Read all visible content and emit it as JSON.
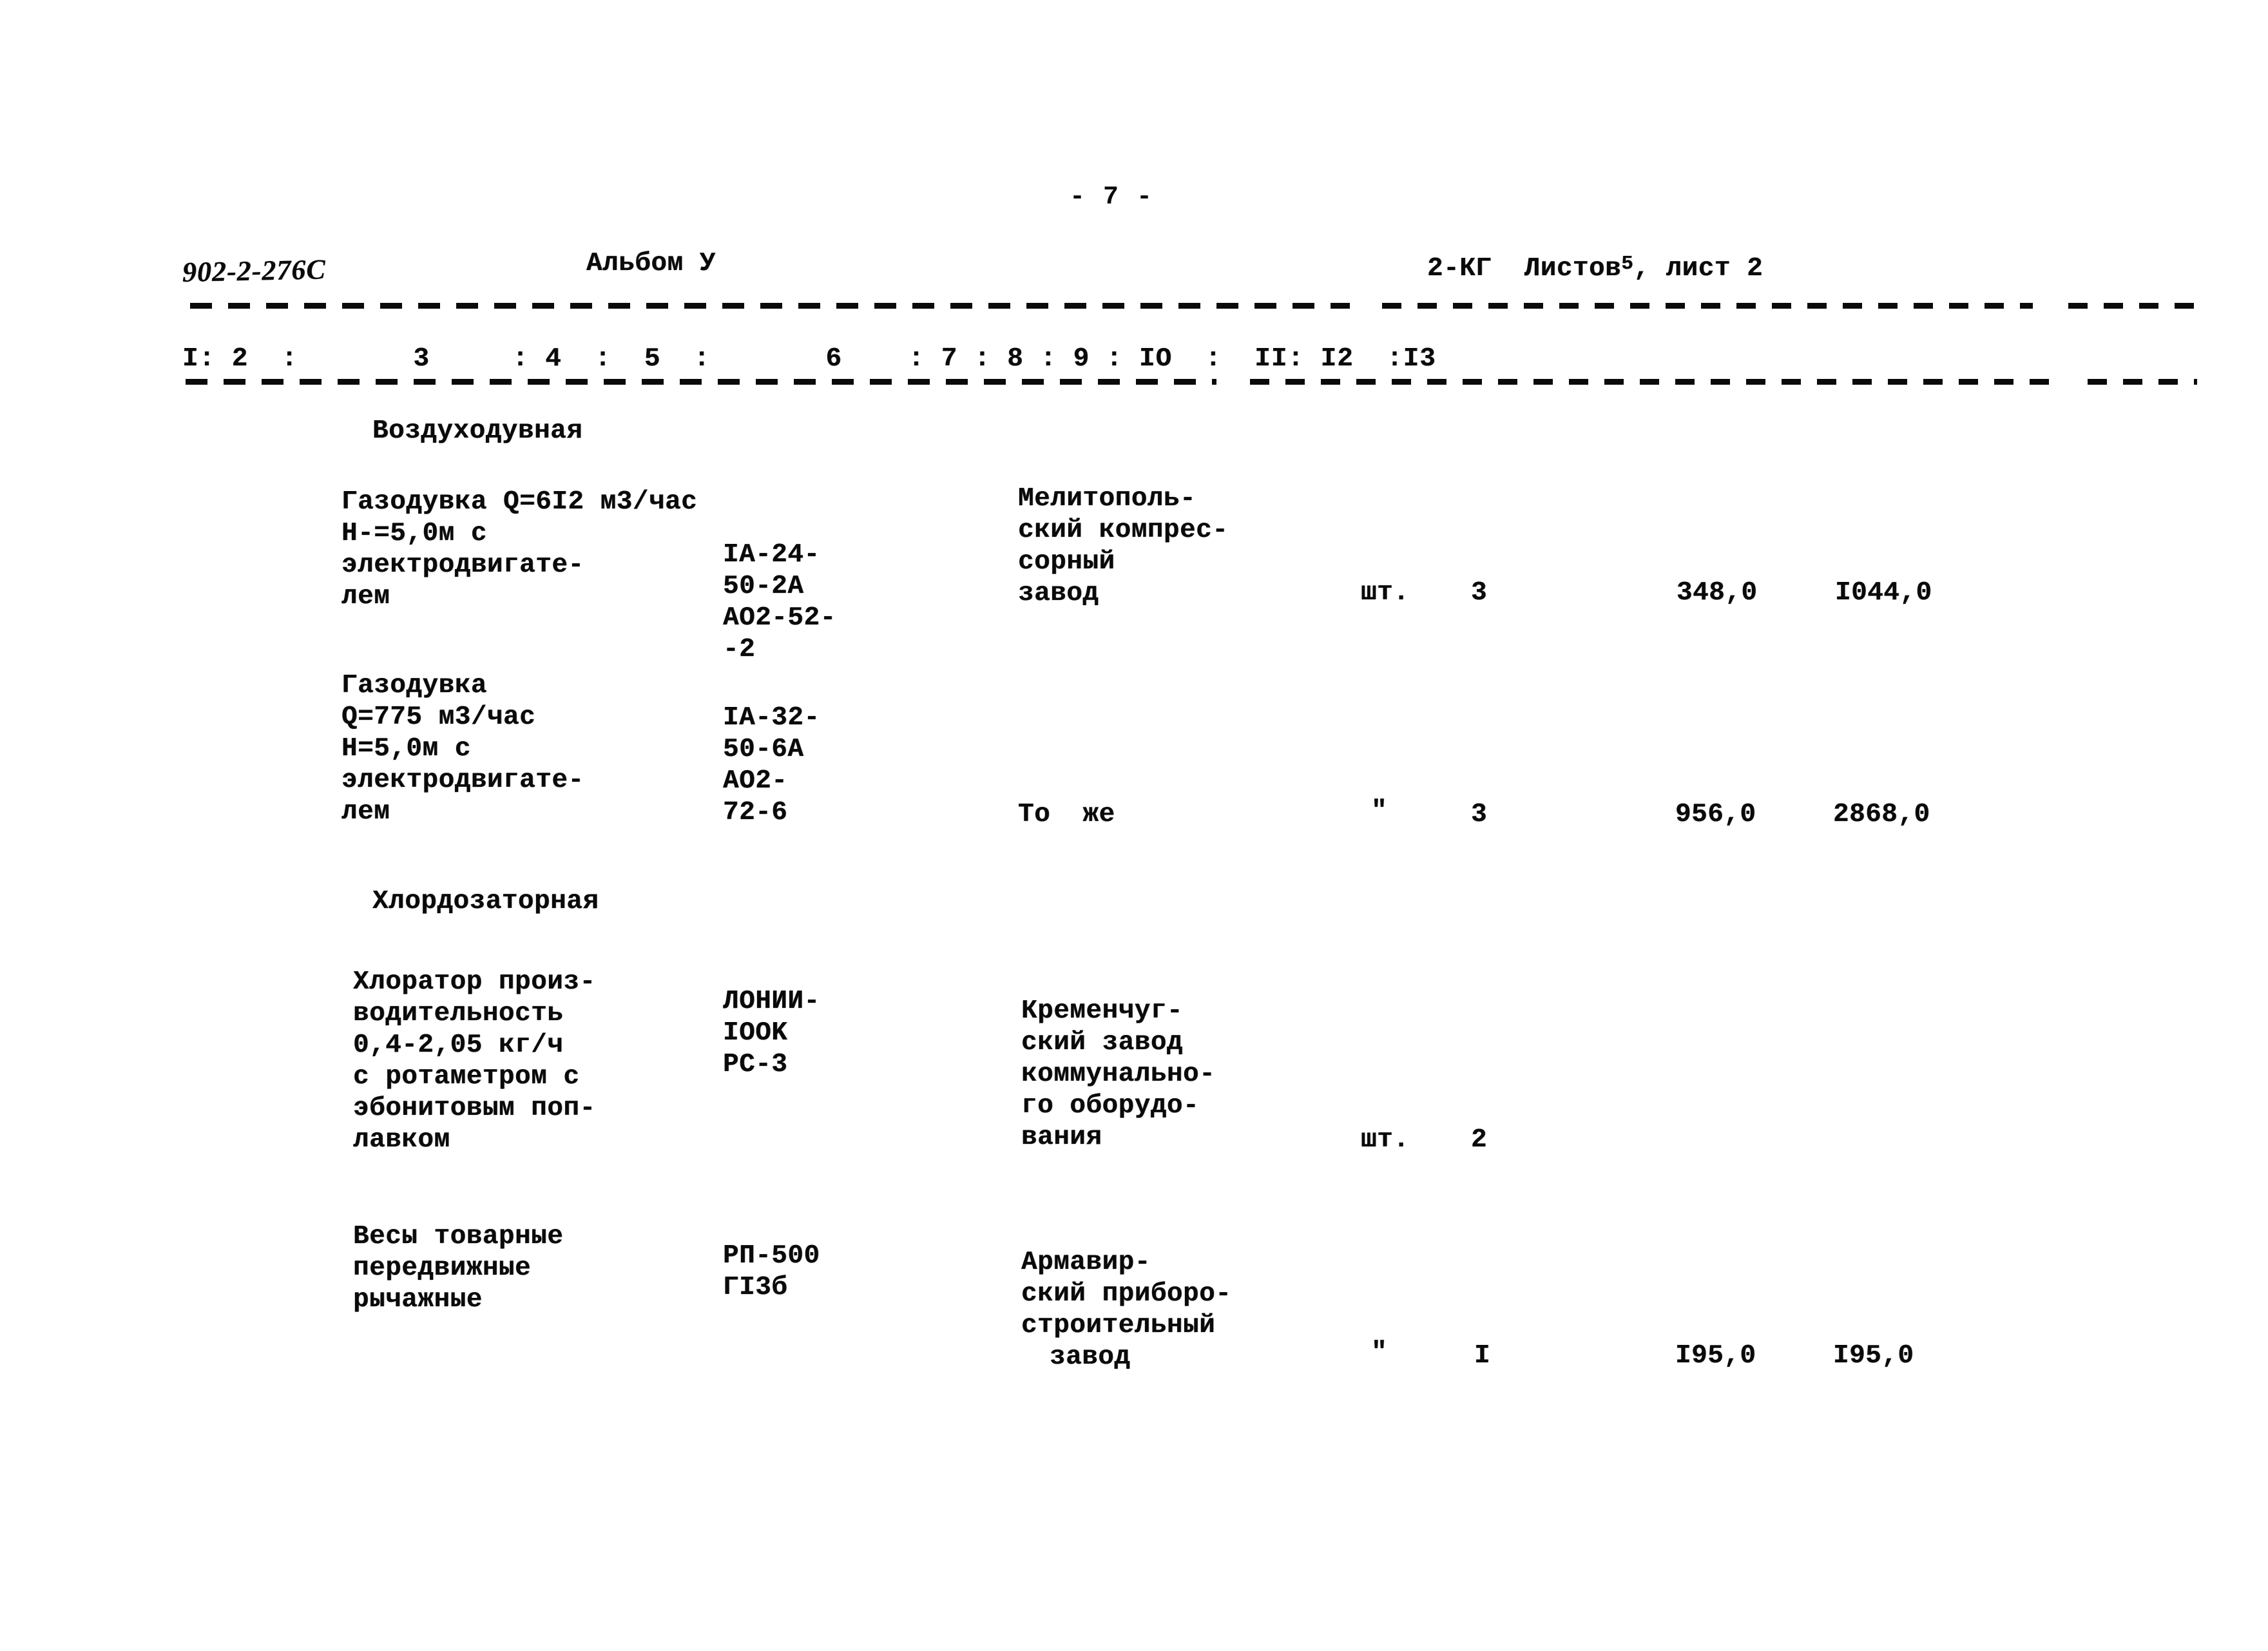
{
  "page": {
    "page_marker": "- 7 -",
    "project_code": "902-2-276С",
    "album_label": "Альбом У",
    "sheet_info_prefix": "2-КГ  Листов",
    "sheet_count": "5",
    "sheet_info_suffix": ", лист 2"
  },
  "column_header": {
    "full_row": "I: 2  :       3     : 4  :  5  :       6    : 7 : 8 : 9 : IO  :  II: I2  :I3",
    "numbers": [
      "I",
      "2",
      "3",
      "4",
      "5",
      "6",
      "7",
      "8",
      "9",
      "IO",
      "II",
      "I2",
      "I3"
    ]
  },
  "sections": [
    {
      "heading": "Воздуходувная",
      "rows": [
        {
          "name_lines": [
            "Газодувка Q=6I2 м3/час",
            "Н-=5,0м с",
            "электродвигате-",
            "лем"
          ],
          "code_lines": [
            "IA-24-",
            "50-2A",
            "AO2-52-",
            "-2"
          ],
          "manufacturer_lines": [
            "Мелитополь-",
            "ский компрес-",
            "сорный",
            "завод"
          ],
          "unit": "шт.",
          "qty": "3",
          "unit_price": "348,0",
          "total_price": "I044,0"
        },
        {
          "name_lines": [
            "Газодувка",
            "Q=775 м3/час",
            "Н=5,0м с",
            "электродвигате-",
            "лем"
          ],
          "code_lines": [
            "IA-32-",
            "50-6A",
            "AO2-",
            "72-6"
          ],
          "manufacturer_lines": [
            "То  же"
          ],
          "unit": "\"",
          "qty": "3",
          "unit_price": "956,0",
          "total_price": "2868,0"
        }
      ]
    },
    {
      "heading": "Хлордозаторная",
      "rows": [
        {
          "name_lines": [
            "Хлоратор произ-",
            "водительность",
            "0,4-2,05 кг/ч",
            "с ротаметром с",
            "эбонитовым поп-",
            "лавком"
          ],
          "code_lines": [
            "ЛОНИИ-",
            "IOOK",
            "PC-3"
          ],
          "manufacturer_lines": [
            "Кременчуг-",
            "ский завод",
            "коммунально-",
            "го оборудо-",
            "вания"
          ],
          "unit": "шт.",
          "qty": "2",
          "unit_price": "",
          "total_price": ""
        },
        {
          "name_lines": [
            "Весы товарные",
            "передвижные",
            "рычажные"
          ],
          "code_lines": [
            "РП-500",
            "ГI3б"
          ],
          "manufacturer_lines": [
            "Армавир-",
            "ский приборо-",
            "строительный",
            "завод"
          ],
          "unit": "\"",
          "qty": "I",
          "unit_price": "I95,0",
          "total_price": "I95,0"
        }
      ]
    }
  ]
}
